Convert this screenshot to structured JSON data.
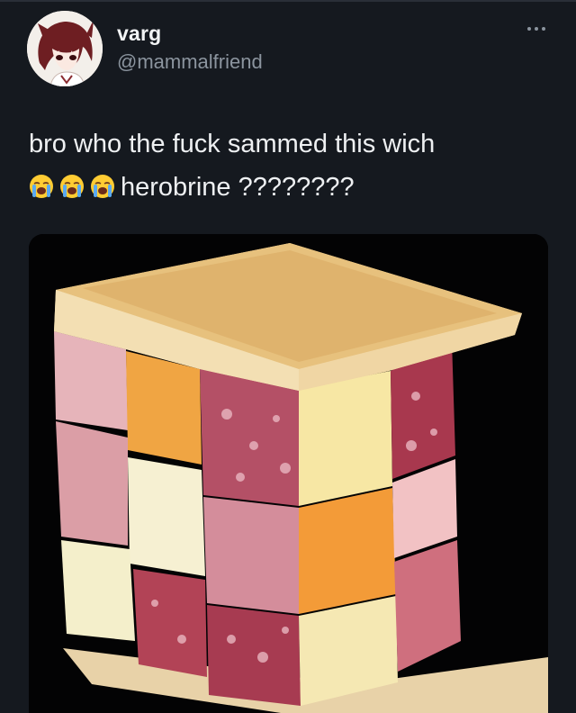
{
  "user": {
    "display_name": "varg",
    "handle": "@mammalfriend",
    "avatar_icon": "anime-avatar-icon"
  },
  "tweet": {
    "line1": "bro who the fuck sammed this wich",
    "emojis": [
      "loudly-crying-face-icon",
      "loudly-crying-face-icon",
      "loudly-crying-face-icon"
    ],
    "line2": "herobrine ????????"
  },
  "media": {
    "image_icon": "ham-cheese-cube-sandwich-image"
  },
  "menu": {
    "icon": "more-options-icon"
  }
}
